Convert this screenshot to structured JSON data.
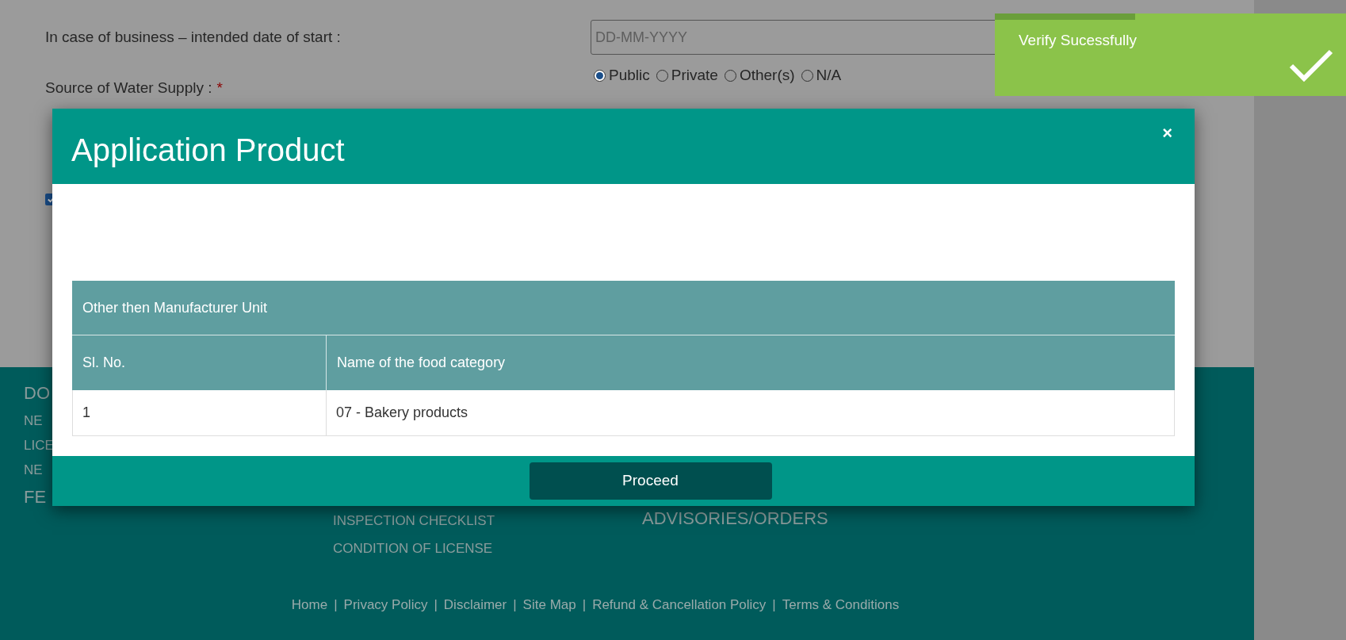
{
  "background_form": {
    "fields": [
      {
        "kind": "date",
        "label": "In case of business – intended date of start :",
        "placeholder": "DD-MM-YYYY"
      },
      {
        "kind": "radio",
        "label": "Source of Water Supply :",
        "required_mark": "*",
        "options": [
          {
            "label": "Public",
            "selected": true
          },
          {
            "label": "Private",
            "selected": false
          },
          {
            "label": "Other(s)",
            "selected": false
          },
          {
            "label": "N/A",
            "selected": false
          }
        ]
      }
    ],
    "checkbox": {
      "checked": true
    }
  },
  "footer": {
    "column_1": [
      {
        "label": "DO",
        "kind": "heading"
      },
      {
        "label": "NE",
        "kind": "link"
      },
      {
        "label": "LICE",
        "kind": "link"
      },
      {
        "label": "NE",
        "kind": "link"
      },
      {
        "label": "FE",
        "kind": "heading"
      }
    ],
    "column_2": [
      "INSPECTION CHECKLIST",
      "CONDITION OF LICENSE"
    ],
    "column_3": [
      "ADVISORIES/ORDERS"
    ],
    "links": [
      "Home",
      "Privacy Policy",
      "Disclaimer",
      "Site Map",
      "Refund & Cancellation Policy",
      "Terms & Conditions"
    ],
    "separator": "|"
  },
  "toast": {
    "message": "Verify Sucessfully",
    "level": 0.4
  },
  "modal": {
    "title": "Application Product",
    "close": "×",
    "table": {
      "caption": "Other then Manufacturer Unit",
      "columns": [
        "Sl. No.",
        "Name of the food category"
      ],
      "rows": [
        [
          "1",
          "07 - Bakery products"
        ]
      ]
    },
    "button": "Proceed"
  }
}
